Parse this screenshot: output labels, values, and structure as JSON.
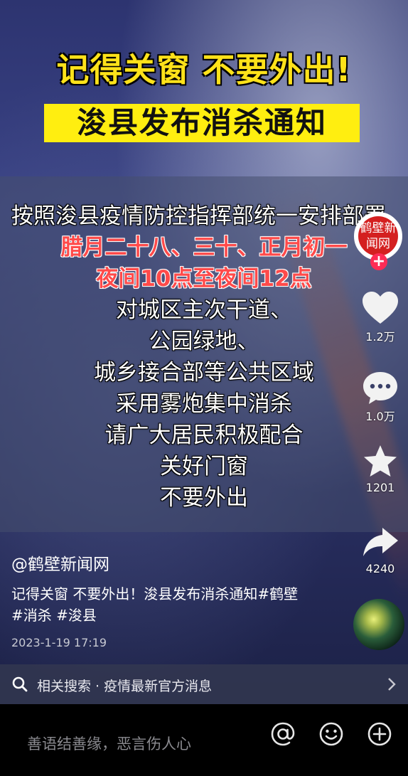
{
  "video": {
    "title_line1": "记得关窗 不要外出!",
    "title_line2": "浚县发布消杀通知",
    "notice_first": "按照浚县疫情防控指挥部统一安排部署",
    "notice_red": [
      "腊月二十八、三十、正月初一",
      "夜间10点至夜间12点"
    ],
    "notice_white": [
      "对城区主次干道、",
      "公园绿地、",
      "城乡接合部等公共区域",
      "采用雾炮集中消杀",
      "请广大居民积极配合",
      "关好门窗",
      "不要外出"
    ]
  },
  "sidebar": {
    "avatar_text": "鹤壁新闻网",
    "follow_label": "+",
    "likes": "1.2万",
    "comments": "1.0万",
    "favorites": "1201",
    "shares": "4240"
  },
  "info": {
    "author": "@鹤壁新闻网",
    "description": "记得关窗 不要外出！浚县发布消杀通知#鹤壁 #消杀 #浚县",
    "date": "2023-1-19 17:19"
  },
  "related_search": {
    "text": "相关搜索 · 疫情最新官方消息"
  },
  "comment_bar": {
    "placeholder": "善语结善缘，恶言伤人心"
  },
  "colors": {
    "title_yellow": "#ffe21a",
    "notice_red": "#ff4a4a",
    "follow_pink": "#fe2c55"
  }
}
